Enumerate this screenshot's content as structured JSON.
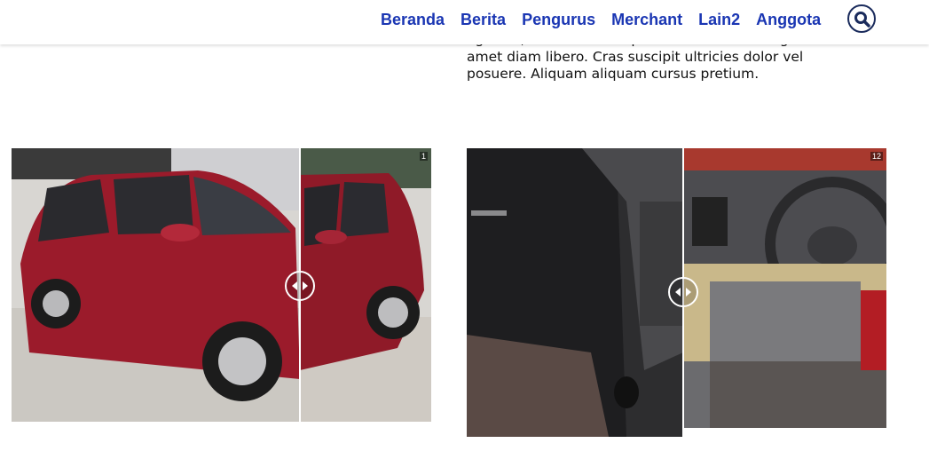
{
  "nav": {
    "items": [
      "Beranda",
      "Berita",
      "Pengurus",
      "Merchant",
      "Lain2",
      "Anggota"
    ]
  },
  "search": {
    "icon": "search-icon"
  },
  "article": {
    "lines": [
      "egestas, non venenatis purus accumsan. Integer sit",
      "amet diam libero. Cras suscipit ultricies dolor vel",
      "posuere. Aliquam aliquam cursus pretium."
    ]
  },
  "compare_exterior": {
    "badge": "1",
    "handle_icon": "left-right-arrows-icon"
  },
  "compare_interior": {
    "badge": "12",
    "handle_icon": "left-right-arrows-icon"
  },
  "colors": {
    "nav_link": "#1a36b3",
    "car_red": "#9b1b2b"
  }
}
